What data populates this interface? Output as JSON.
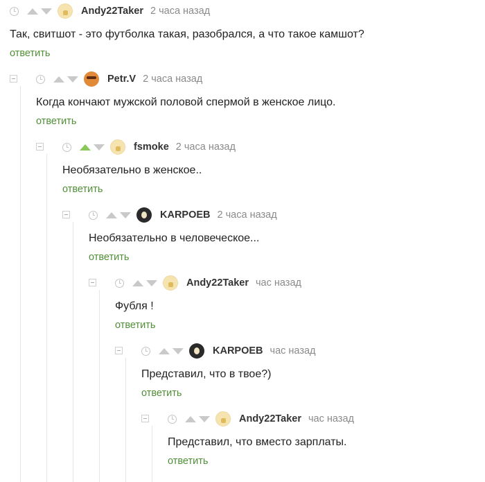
{
  "reply_label": "ответить",
  "comments": [
    {
      "author": "Andy22Taker",
      "time": "2 часа назад",
      "text": "Так, свитшот - это футболка такая, разобрался, а что такое камшот?",
      "avatar": "cream-avatar",
      "upvoted": false
    },
    {
      "author": "Petr.V",
      "time": "2 часа назад",
      "text": "Когда кончают мужской половой спермой в женское лицо.",
      "avatar": "orange-avatar",
      "upvoted": false
    },
    {
      "author": "fsmoke",
      "time": "2 часа назад",
      "text": "Необязательно в женское..",
      "avatar": "cream-avatar",
      "upvoted": true
    },
    {
      "author": "KARPOEB",
      "time": "2 часа назад",
      "text": "Необязательно в человеческое...",
      "avatar": "dark-avatar",
      "upvoted": false
    },
    {
      "author": "Andy22Taker",
      "time": "час назад",
      "text": "Фубля !",
      "avatar": "cream-avatar",
      "upvoted": false
    },
    {
      "author": "KARPOEB",
      "time": "час назад",
      "text": "Представил, что в твое?)",
      "avatar": "dark-avatar",
      "upvoted": false
    },
    {
      "author": "Andy22Taker",
      "time": "час назад",
      "text": "Представил, что вместо зарплаты.",
      "avatar": "cream-avatar",
      "upvoted": false
    }
  ],
  "colors": {
    "reply_link": "#4f8f36",
    "upvote_active": "#8ac858",
    "icon_gray": "#c9c9c9"
  }
}
